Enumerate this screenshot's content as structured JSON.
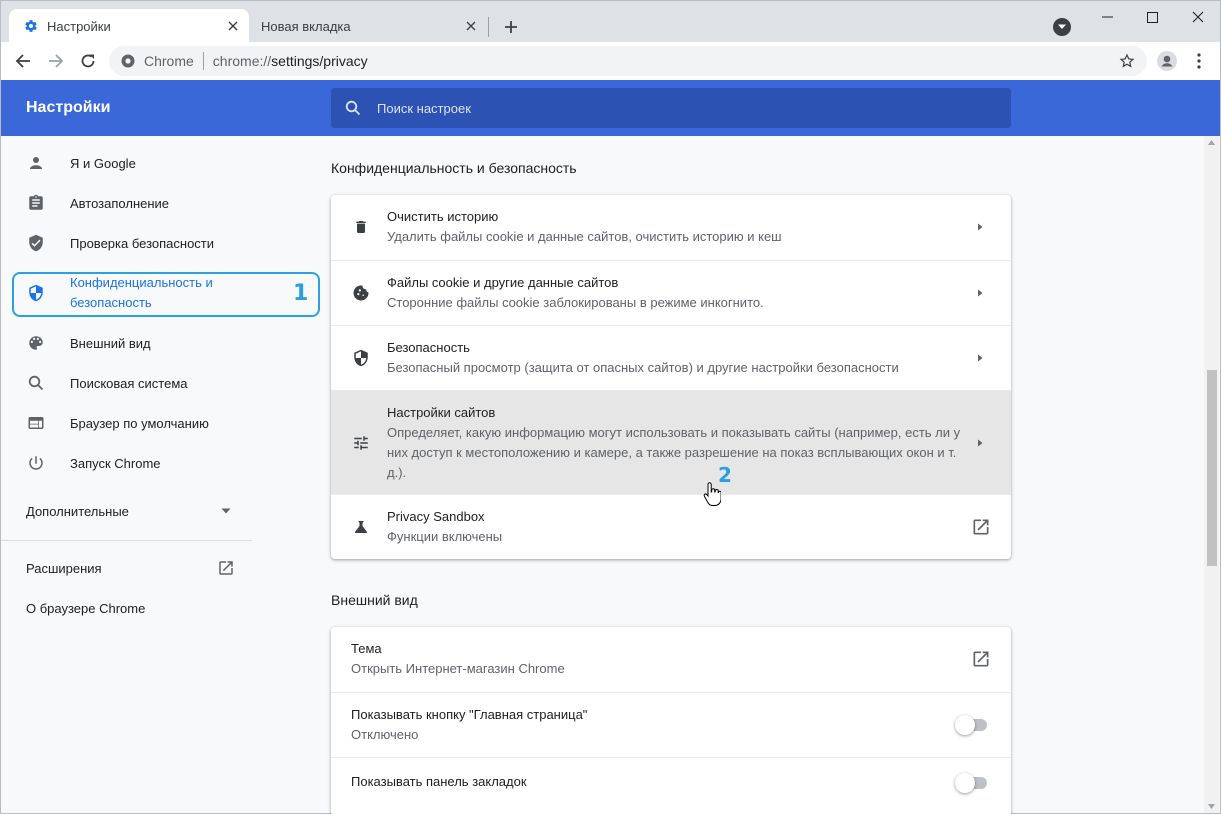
{
  "tabs": [
    {
      "title": "Настройки",
      "icon": "gear-icon"
    },
    {
      "title": "Новая вкладка"
    }
  ],
  "omnibox": {
    "site": "Chrome",
    "url_prefix": "chrome://",
    "url_path": "settings/privacy"
  },
  "header": {
    "title": "Настройки",
    "search_placeholder": "Поиск настроек"
  },
  "sidebar": {
    "items": [
      {
        "label": "Я и Google",
        "icon": "person-icon"
      },
      {
        "label": "Автозаполнение",
        "icon": "clipboard-icon"
      },
      {
        "label": "Проверка безопасности",
        "icon": "shield-check-icon"
      },
      {
        "label": "Конфиденциальность и безопасность",
        "icon": "privacy-shield-icon",
        "selected": true
      },
      {
        "label": "Внешний вид",
        "icon": "palette-icon"
      },
      {
        "label": "Поисковая система",
        "icon": "search-icon"
      },
      {
        "label": "Браузер по умолчанию",
        "icon": "browser-icon"
      },
      {
        "label": "Запуск Chrome",
        "icon": "power-icon"
      }
    ],
    "advanced": "Дополнительные",
    "extensions": "Расширения",
    "about": "О браузере Chrome"
  },
  "annotations": {
    "step1": "1",
    "step2": "2"
  },
  "privacy": {
    "title": "Конфиденциальность и безопасность",
    "rows": [
      {
        "title": "Очистить историю",
        "sub": "Удалить файлы cookie и данные сайтов, очистить историю и кеш",
        "icon": "trash-icon"
      },
      {
        "title": "Файлы cookie и другие данные сайтов",
        "sub": "Сторонние файлы cookie заблокированы в режиме инкогнито.",
        "icon": "cookie-icon"
      },
      {
        "title": "Безопасность",
        "sub": "Безопасный просмотр (защита от опасных сайтов) и другие настройки безопасности",
        "icon": "shield-icon"
      },
      {
        "title": "Настройки сайтов",
        "sub": "Определяет, какую информацию могут использовать и показывать сайты (например, есть ли у них доступ к местоположению и камере, а также разрешение на показ всплывающих окон и т. д.).",
        "icon": "tune-icon"
      },
      {
        "title": "Privacy Sandbox",
        "sub": "Функции включены",
        "icon": "flask-icon"
      }
    ]
  },
  "appearance": {
    "title": "Внешний вид",
    "rows": [
      {
        "title": "Тема",
        "sub": "Открыть Интернет-магазин Chrome"
      },
      {
        "title": "Показывать кнопку \"Главная страница\"",
        "sub": "Отключено"
      },
      {
        "title": "Показывать панель закладок"
      }
    ]
  },
  "colors": {
    "accent": "#1a73e8",
    "header": "#3b68d8",
    "annotation": "#2a9ee0"
  }
}
